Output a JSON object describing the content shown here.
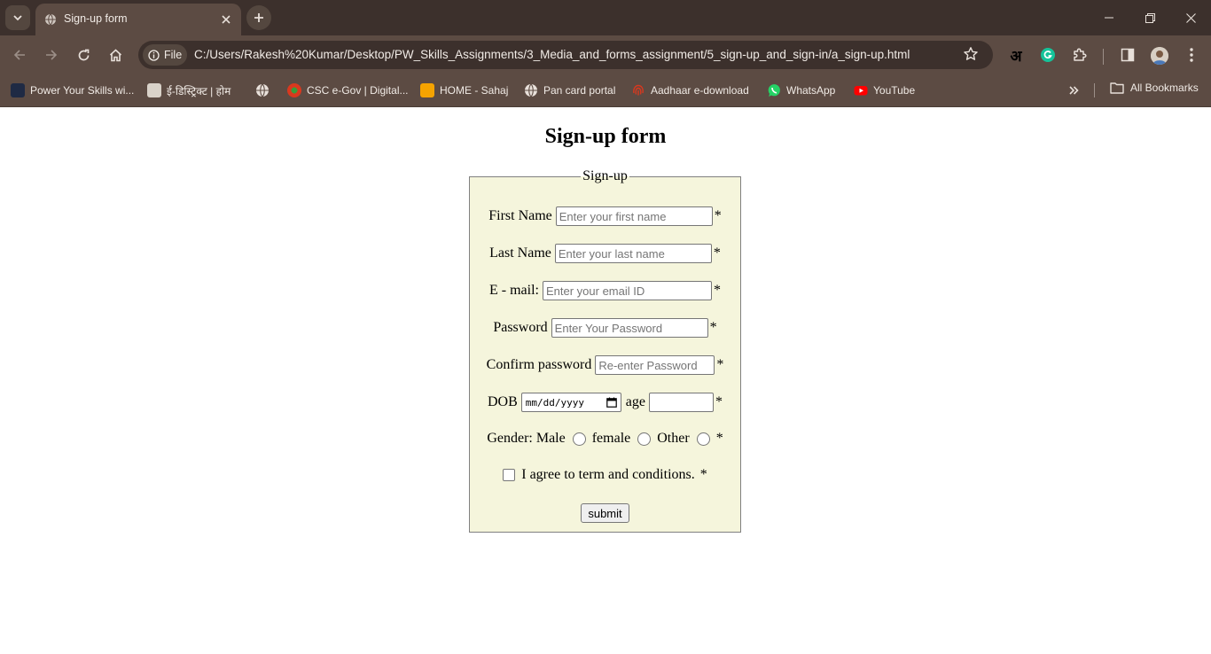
{
  "browser": {
    "tab_title": "Sign-up form",
    "file_chip": "File",
    "url": "C:/Users/Rakesh%20Kumar/Desktop/PW_Skills_Assignments/3_Media_and_forms_assignment/5_sign-up_and_sign-in/a_sign-up.html",
    "ext_letter": "अ",
    "bookmarks": [
      {
        "label": "Power Your Skills wi...",
        "color": "#1f2a44"
      },
      {
        "label": "ई-डिस्ट्रिक्ट | होम",
        "color": "#d9d2c9"
      },
      {
        "label": "",
        "color": "#e8e0da"
      },
      {
        "label": "CSC e-Gov | Digital...",
        "color": "#d9381e"
      },
      {
        "label": "HOME - Sahaj",
        "color": "#f5a300"
      },
      {
        "label": "Pan card portal",
        "color": "#e8e0da"
      },
      {
        "label": "Aadhaar e-download",
        "color": "#d9381e"
      },
      {
        "label": "WhatsApp",
        "color": "#25d366"
      },
      {
        "label": "YouTube",
        "color": "#ff0000"
      }
    ],
    "all_bookmarks": "All Bookmarks"
  },
  "page": {
    "heading": "Sign-up form",
    "legend": "Sign-up",
    "first_name": {
      "label": "First Name",
      "placeholder": "Enter your first name"
    },
    "last_name": {
      "label": "Last Name",
      "placeholder": "Enter your last name"
    },
    "email": {
      "label": "E - mail:",
      "placeholder": "Enter your email ID"
    },
    "password": {
      "label": "Password",
      "placeholder": "Enter Your Password"
    },
    "confirm": {
      "label": "Confirm password",
      "placeholder": "Re-enter Password"
    },
    "dob": {
      "label": "DOB",
      "value": "mm/dd/yyyy"
    },
    "age": {
      "label": "age"
    },
    "gender": {
      "label": "Gender:",
      "male": "Male",
      "female": "female",
      "other": "Other"
    },
    "agree": "I agree to term and conditions.",
    "required": "*",
    "submit": "submit"
  },
  "colors": {
    "form_bg": "#f5f5dc",
    "chrome_dark": "#3c302c",
    "chrome_mid": "#5c4b43"
  }
}
